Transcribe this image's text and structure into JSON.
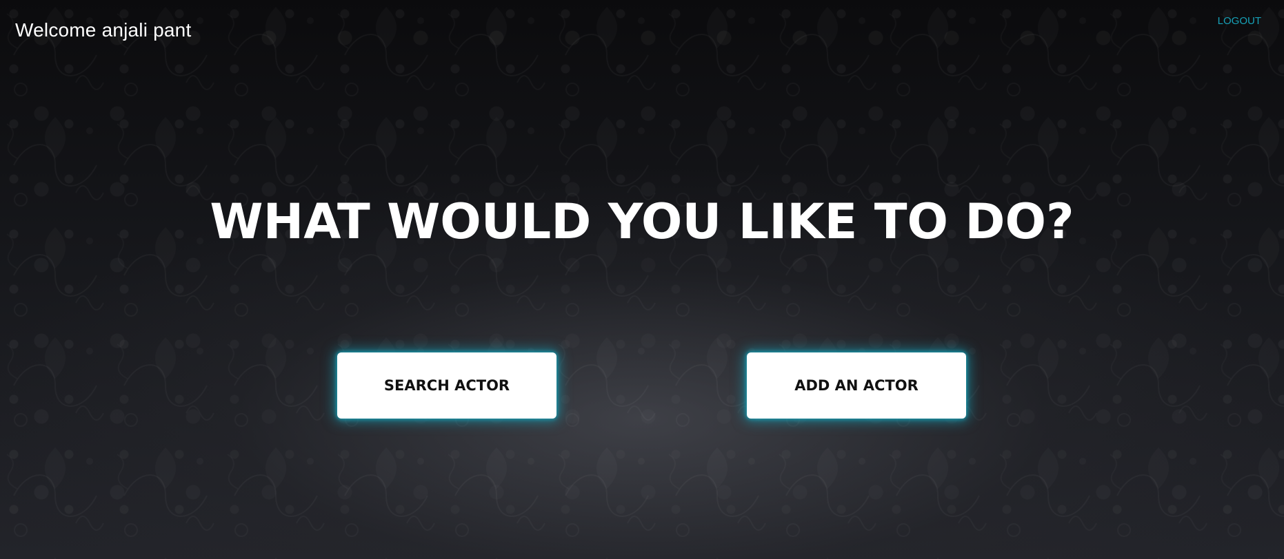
{
  "header": {
    "welcome_text": "Welcome anjali pant",
    "logout_label": "LOGOUT"
  },
  "main": {
    "headline": "WHAT WOULD YOU LIKE TO DO?",
    "actions": [
      {
        "label": "SEARCH ACTOR"
      },
      {
        "label": "ADD AN ACTOR"
      }
    ]
  },
  "colors": {
    "accent": "#17a2b8",
    "background": "#15161a",
    "button_bg": "#ffffff",
    "text_light": "#ffffff"
  },
  "background": {
    "pattern_icon": "floral-damask-pattern"
  }
}
